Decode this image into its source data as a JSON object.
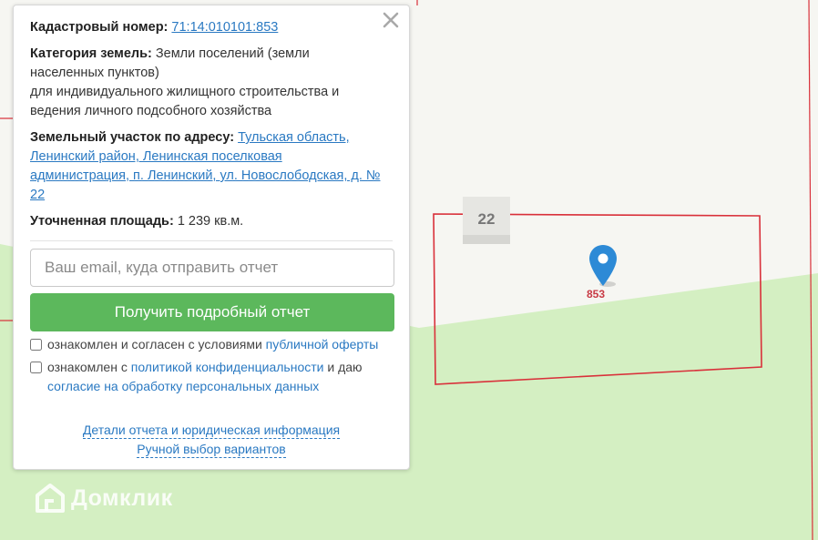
{
  "popup": {
    "cadastral_label": "Кадастровый номер:",
    "cadastral_number": "71:14:010101:853",
    "category_label": "Категория земель:",
    "category_line1": "Земли поселений (земли",
    "category_line2": "населенных пунктов)",
    "category_line3": "для индивидуального жилищного строительства и",
    "category_line4": "ведения личного подсобного хозяйства",
    "address_label": "Земельный участок по адресу:",
    "address_line1": "Тульская область,",
    "address_line2": "Ленинский район, Ленинская поселковая",
    "address_line3": "администрация, п. Ленинский, ул. Новослободская, д. №",
    "address_line4": "22",
    "area_label": "Уточненная площадь:",
    "area_value": "1 239 кв.м.",
    "email_placeholder": "Ваш email, куда отправить отчет",
    "email_value": "",
    "submit_label": "Получить подробный отчет",
    "consent1_text": "ознакомлен и согласен с условиями",
    "consent1_link": "публичной оферты",
    "consent2_text": "ознакомлен с",
    "consent2_link": "политикой конфиденциальности",
    "consent2_text2": "и даю",
    "consent2_link2": "согласие на обработку персональных данных",
    "details_link": "Детали отчета и юридическая информация",
    "manual_link": "Ручной выбор вариантов"
  },
  "map": {
    "house_number": "22",
    "parcel_number": "853",
    "watermark": "Домклик",
    "colors": {
      "background": "#f6f6f2",
      "green_area": "#d4efc2",
      "parcel_border": "#d9303a",
      "pin": "#2d8ad6",
      "button": "#5cb85c",
      "link": "#2a79c2"
    }
  },
  "icons": {
    "close": "close-icon",
    "pin": "map-pin-icon",
    "logo": "domclick-logo-icon"
  }
}
